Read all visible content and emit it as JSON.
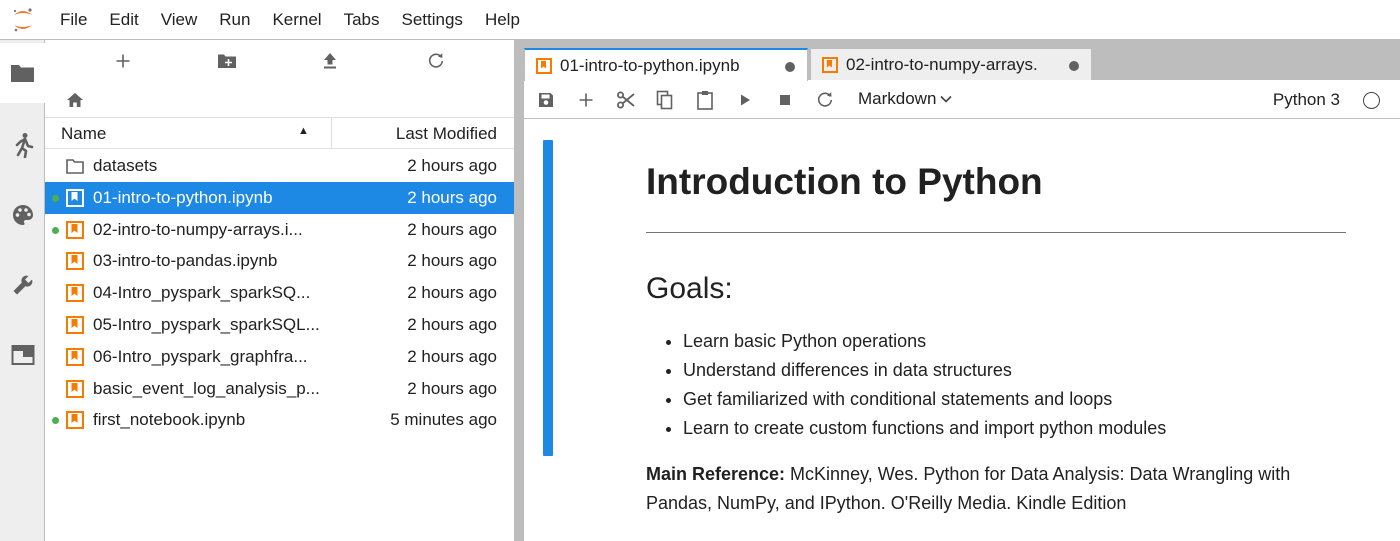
{
  "menubar": {
    "items": [
      "File",
      "Edit",
      "View",
      "Run",
      "Kernel",
      "Tabs",
      "Settings",
      "Help"
    ]
  },
  "sidebar_icons": [
    "folder-icon",
    "running-icon",
    "palette-icon",
    "wrench-icon",
    "tabs-icon"
  ],
  "filebrowser": {
    "toolbar_icons": [
      "new-launcher-icon",
      "new-folder-icon",
      "upload-icon",
      "refresh-icon"
    ],
    "header": {
      "name": "Name",
      "last_modified": "Last Modified"
    },
    "items": [
      {
        "name": "datasets",
        "modified": "2 hours ago",
        "type": "folder",
        "running": false,
        "selected": false
      },
      {
        "name": "01-intro-to-python.ipynb",
        "modified": "2 hours ago",
        "type": "notebook",
        "running": true,
        "selected": true
      },
      {
        "name": "02-intro-to-numpy-arrays.i...",
        "modified": "2 hours ago",
        "type": "notebook",
        "running": true,
        "selected": false
      },
      {
        "name": "03-intro-to-pandas.ipynb",
        "modified": "2 hours ago",
        "type": "notebook",
        "running": false,
        "selected": false
      },
      {
        "name": "04-Intro_pyspark_sparkSQ...",
        "modified": "2 hours ago",
        "type": "notebook",
        "running": false,
        "selected": false
      },
      {
        "name": "05-Intro_pyspark_sparkSQL...",
        "modified": "2 hours ago",
        "type": "notebook",
        "running": false,
        "selected": false
      },
      {
        "name": "06-Intro_pyspark_graphfra...",
        "modified": "2 hours ago",
        "type": "notebook",
        "running": false,
        "selected": false
      },
      {
        "name": "basic_event_log_analysis_p...",
        "modified": "2 hours ago",
        "type": "notebook",
        "running": false,
        "selected": false
      },
      {
        "name": "first_notebook.ipynb",
        "modified": "5 minutes ago",
        "type": "notebook",
        "running": true,
        "selected": false
      }
    ]
  },
  "tabs": [
    {
      "label": "01-intro-to-python.ipynb",
      "active": true
    },
    {
      "label": "02-intro-to-numpy-arrays.",
      "active": false
    }
  ],
  "notebook_toolbar": {
    "cell_type": "Markdown",
    "kernel": "Python 3"
  },
  "notebook": {
    "title": "Introduction to Python",
    "goals_heading": "Goals:",
    "goals": [
      "Learn basic Python operations",
      "Understand differences in data structures",
      "Get familiarized with conditional statements and loops",
      "Learn to create custom functions and import python modules"
    ],
    "reference_label": "Main Reference:",
    "reference_text": " McKinney, Wes. Python for Data Analysis: Data Wrangling with Pandas, NumPy, and IPython. O'Reilly Media. Kindle Edition"
  },
  "colors": {
    "accent": "#1e88e5",
    "notebook_icon": "#f57c00",
    "running": "#4caf50",
    "logo": "#f37726"
  }
}
